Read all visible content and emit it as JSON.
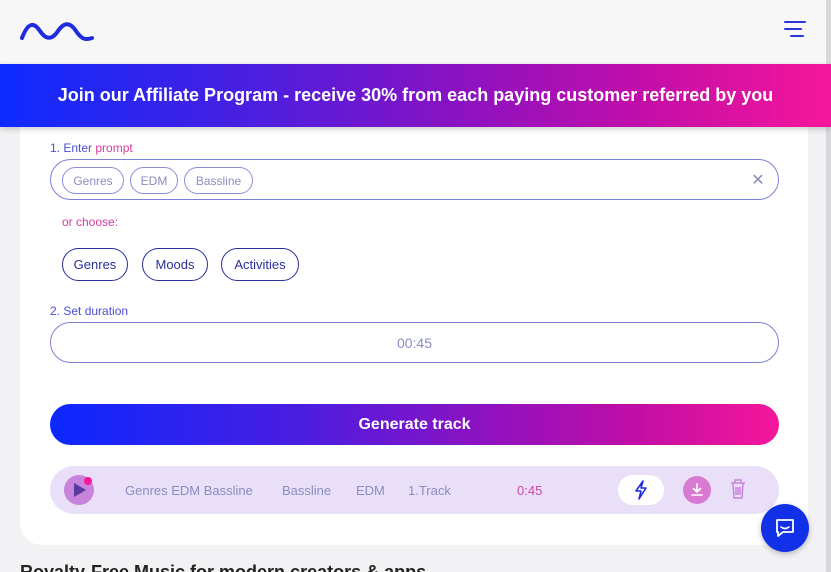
{
  "banner": {
    "text": "Join our Affiliate Program - receive 30% from each paying customer referred by you"
  },
  "prompt": {
    "label_num": "1. Enter ",
    "label_word": "prompt",
    "chips": [
      "Genres",
      "EDM",
      "Bassline"
    ],
    "clear_icon": "close-icon"
  },
  "choose": {
    "label": "or choose:",
    "buttons": [
      "Genres",
      "Moods",
      "Activities"
    ]
  },
  "duration": {
    "label": "2. Set duration",
    "value": "00:45"
  },
  "generate": {
    "label": "Generate track"
  },
  "track": {
    "title": "Genres EDM Bassline",
    "tag1": "Bassline",
    "tag2": "EDM",
    "track_num": "1.",
    "track_word": "Track",
    "duration": "0:45"
  },
  "footer": {
    "heading": "Royalty-Free Music for modern creators & apps"
  },
  "colors": {
    "accent": "#2b36d9",
    "pink": "#f5169a",
    "track_bg": "#e9dff8"
  },
  "icons": {
    "logo": "wave-logo-icon",
    "menu": "hamburger-menu-icon",
    "play": "play-icon",
    "bolt": "lightning-icon",
    "download": "download-icon",
    "trash": "trash-icon",
    "chat": "chat-icon"
  }
}
